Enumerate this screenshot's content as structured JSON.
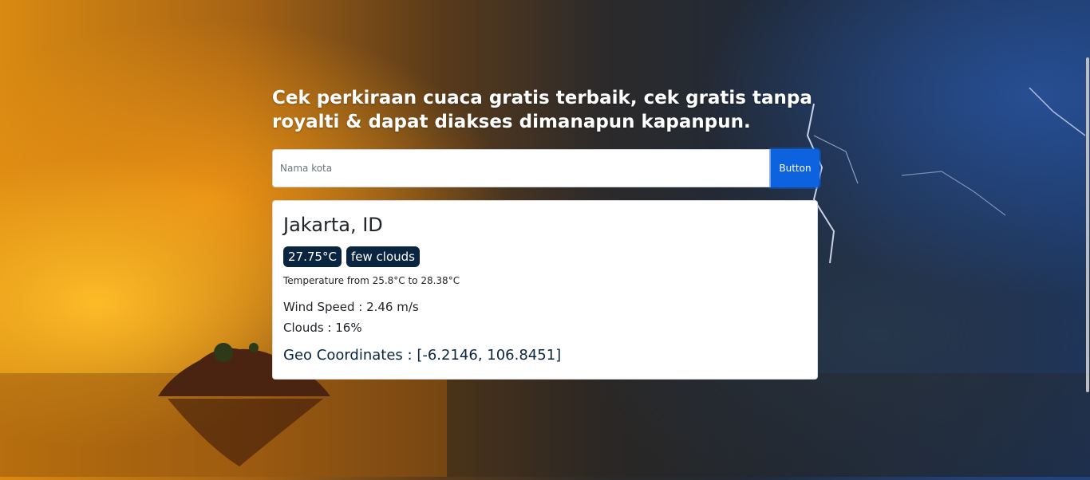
{
  "headline": "Cek perkiraan cuaca gratis terbaik, cek gratis tanpa royalti & dapat diakses dimanapun kapanpun.",
  "search": {
    "placeholder": "Nama kota",
    "value": "",
    "button_label": "Button"
  },
  "weather": {
    "city": "Jakarta, ID",
    "temperature_badge": "27.75°C",
    "condition_badge": "few clouds",
    "temperature_range": "Temperature from 25.8°C to 28.38°C",
    "wind_speed": "Wind Speed : 2.46 m/s",
    "clouds": "Clouds : 16%",
    "geo_coordinates": "Geo Coordinates : [-6.2146, 106.8451]"
  },
  "colors": {
    "button": "#0d62e0",
    "badge": "#0a2540"
  }
}
